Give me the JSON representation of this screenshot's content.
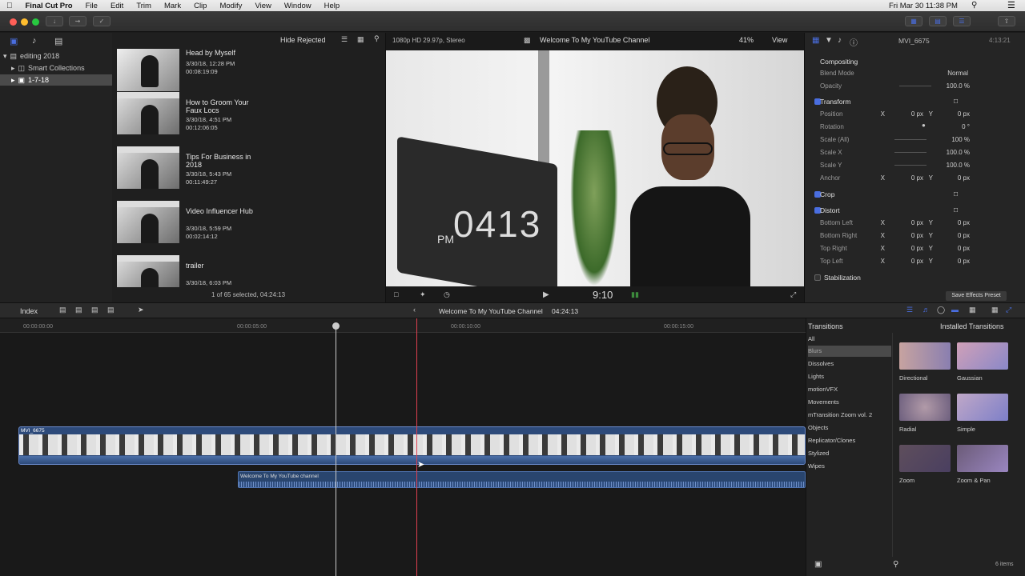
{
  "menubar": {
    "app": "Final Cut Pro",
    "items": [
      "File",
      "Edit",
      "Trim",
      "Mark",
      "Clip",
      "Modify",
      "View",
      "Window",
      "Help"
    ],
    "clock": "Fri Mar 30  11:38 PM"
  },
  "library": {
    "items": [
      {
        "label": "editing 2018"
      },
      {
        "label": "Smart Collections"
      },
      {
        "label": "1-7-18"
      }
    ]
  },
  "browser": {
    "filter": "Hide Rejected",
    "status": "1 of 65 selected, 04:24:13",
    "clips": [
      {
        "title": "Head by Myself",
        "date": "3/30/18, 12:28 PM",
        "dur": "00:08:19:09"
      },
      {
        "title": "How to Groom Your Faux Locs",
        "date": "3/30/18, 4:51 PM",
        "dur": "00:12:06:05"
      },
      {
        "title": "Tips For Business in 2018",
        "date": "3/30/18, 5:43 PM",
        "dur": "00:11:49:27"
      },
      {
        "title": "Video Influencer Hub",
        "date": "3/30/18, 5:59 PM",
        "dur": "00:02:14:12"
      },
      {
        "title": "trailer",
        "date": "3/30/18, 6:03 PM",
        "dur": ""
      }
    ]
  },
  "viewer": {
    "format": "1080p HD 29.97p, Stereo",
    "title": "Welcome To My YouTube Channel",
    "zoom": "41%",
    "view": "View",
    "timecode": "9:10",
    "monitor_pm": "PM",
    "monitor_time": "0413"
  },
  "inspector": {
    "clip": "MVI_6675",
    "dur": "4:13:21",
    "compositing": "Compositing",
    "blend_label": "Blend Mode",
    "blend": "Normal",
    "opacity_label": "Opacity",
    "opacity": "100.0 %",
    "transform": "Transform",
    "position_label": "Position",
    "rotation_label": "Rotation",
    "scale_all_label": "Scale (All)",
    "scale_x_label": "Scale X",
    "scale_y_label": "Scale Y",
    "anchor_label": "Anchor",
    "px": "0 px",
    "deg": "0 °",
    "pct100": "100 %",
    "pct1000": "100.0 %",
    "x": "X",
    "y": "Y",
    "crop": "Crop",
    "distort": "Distort",
    "bl": "Bottom Left",
    "br": "Bottom Right",
    "tr": "Top Right",
    "tl": "Top Left",
    "stabilization": "Stabilization",
    "save_preset": "Save Effects Preset"
  },
  "timeline": {
    "index": "Index",
    "project": "Welcome To My YouTube Channel",
    "duration": "04:24:13",
    "ruler": [
      "00:00:00:00",
      "00:00:05:00",
      "00:00:10:00",
      "00:00:15:00"
    ],
    "video_clip": "MVI_6675",
    "audio_clip": "Welcome To My YouTube channel"
  },
  "transitions": {
    "title": "Transitions",
    "installed": "Installed Transitions",
    "categories": [
      "All",
      "Blurs",
      "Dissolves",
      "Lights",
      "motionVFX",
      "Movements",
      "mTransition Zoom vol. 2",
      "Objects",
      "Replicator/Clones",
      "Stylized",
      "Wipes"
    ],
    "items": [
      "Directional",
      "Gaussian",
      "Radial",
      "Simple",
      "Zoom",
      "Zoom & Pan"
    ],
    "count": "6 items"
  },
  "colors": {
    "accent": "#4a6ee0",
    "playhead": "#c8c8c8",
    "skimmer": "#e04050"
  }
}
